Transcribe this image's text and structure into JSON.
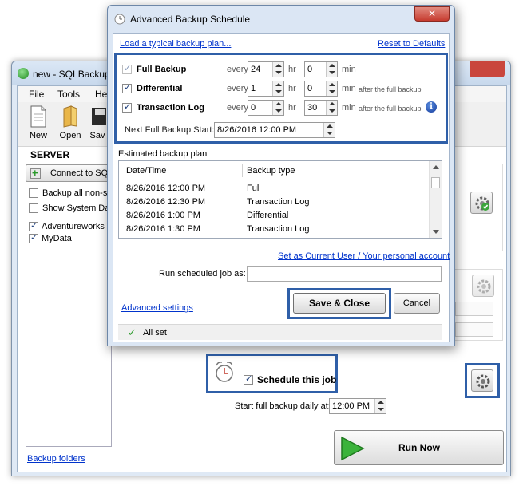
{
  "main_window": {
    "title": "new - SQLBackup",
    "menu": [
      "File",
      "Tools",
      "He"
    ],
    "toolbar": [
      {
        "label": "New",
        "icon": "new-file-icon"
      },
      {
        "label": "Open",
        "icon": "folder-open-icon"
      },
      {
        "label": "Sav",
        "icon": "save-icon"
      }
    ],
    "server_heading": "SERVER",
    "connect_label": "Connect to SQ",
    "backup_all_label": "Backup all non-sy",
    "show_system_label": "Show System Dat",
    "databases": [
      {
        "name": "Adventureworks",
        "checked": true
      },
      {
        "name": "MyData",
        "checked": true
      }
    ],
    "backup_folders_link": "Backup folders",
    "schedule_label": "Schedule this job",
    "start_full_label": "Start full backup daily at:",
    "start_full_time": "12:00 PM",
    "run_now_label": "Run Now"
  },
  "dialog": {
    "title": "Advanced Backup Schedule",
    "load_plan_link": "Load a typical backup plan...",
    "reset_link": "Reset to Defaults",
    "rows": [
      {
        "label": "Full Backup",
        "every": "every",
        "hr_value": "24",
        "hr_unit": "hr",
        "min_value": "0",
        "min_unit": "min",
        "note": "",
        "checked": true
      },
      {
        "label": "Differential",
        "every": "every",
        "hr_value": "1",
        "hr_unit": "hr",
        "min_value": "0",
        "min_unit": "min",
        "note": "after the full backup",
        "checked": true
      },
      {
        "label": "Transaction Log",
        "every": "every",
        "hr_value": "0",
        "hr_unit": "hr",
        "min_value": "30",
        "min_unit": "min",
        "note": "after the full backup",
        "checked": true
      }
    ],
    "next_full_label": "Next Full Backup Start:",
    "next_full_value": "8/26/2016 12:00 PM",
    "estimated_label": "Estimated backup plan",
    "table_headers": [
      "Date/Time",
      "Backup type"
    ],
    "table_rows": [
      [
        "8/26/2016 12:00 PM",
        "Full"
      ],
      [
        "8/26/2016 12:30 PM",
        "Transaction Log"
      ],
      [
        "8/26/2016 1:00 PM",
        "Differential"
      ],
      [
        "8/26/2016 1:30 PM",
        "Transaction Log"
      ]
    ],
    "set_user_link": "Set as Current User / Your personal account",
    "run_as_label": "Run scheduled job as:",
    "run_as_value": "",
    "advanced_link": "Advanced settings",
    "save_label": "Save & Close",
    "cancel_label": "Cancel",
    "status_text": "All set",
    "info_glyph": "i"
  },
  "colors": {
    "highlight": "#2f5fa8",
    "link": "#0033cc",
    "ok_green": "#2a9a2a"
  }
}
